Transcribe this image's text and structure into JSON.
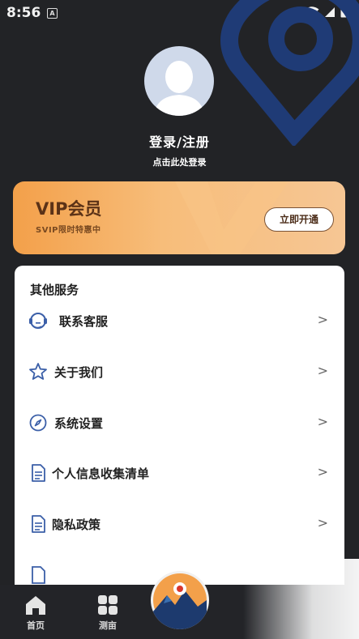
{
  "status_bar": {
    "time": "8:56",
    "notif_icon": "A"
  },
  "profile": {
    "title": "登录/注册",
    "subtitle": "点击此处登录"
  },
  "vip": {
    "title": "VIP会员",
    "subtitle": "SVIP限时特惠中",
    "button": "立即开通"
  },
  "services": {
    "title": "其他服务",
    "items": [
      {
        "label": "联系客服",
        "icon": "headset-icon"
      },
      {
        "label": "关于我们",
        "icon": "star-icon"
      },
      {
        "label": "系统设置",
        "icon": "compass-icon"
      },
      {
        "label": "个人信息收集清单",
        "icon": "document-icon"
      },
      {
        "label": "隐私政策",
        "icon": "document-icon"
      }
    ],
    "chevron": ">"
  },
  "bottom_nav": {
    "home_label": "首页",
    "measure_label": "测亩"
  },
  "colors": {
    "background": "#222326",
    "vip_gradient_start": "#f3a04a",
    "vip_gradient_end": "#f6c694",
    "decor_blue": "#1f3b76"
  }
}
